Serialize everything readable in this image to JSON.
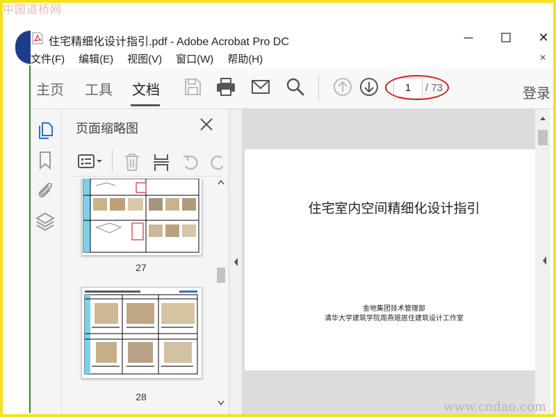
{
  "watermarks": {
    "top": "中国道桥网",
    "bottom": "www.cndao.com"
  },
  "window": {
    "title": "住宅精细化设计指引.pdf - Adobe Acrobat Pro DC",
    "minimize": "─",
    "close": "✕"
  },
  "menu": {
    "items": [
      {
        "label": "文件(F)"
      },
      {
        "label": "编辑(E)"
      },
      {
        "label": "视图(V)"
      },
      {
        "label": "窗口(W)"
      },
      {
        "label": "帮助(H)"
      }
    ],
    "close": "✕"
  },
  "toolbar": {
    "tabs": [
      {
        "label": "主页"
      },
      {
        "label": "工具"
      },
      {
        "label": "文档"
      }
    ],
    "active_tab": "文档",
    "icons": [
      "save-icon",
      "print-icon",
      "email-icon",
      "search-icon",
      "prev-page-icon",
      "next-page-icon"
    ],
    "page_number": "1",
    "page_total": "/ 73",
    "login": "登录",
    "highlight_color": "#d21f1f"
  },
  "left_rail": {
    "icons": [
      "page-thumbnails-icon",
      "bookmark-icon",
      "attachment-icon",
      "layers-icon"
    ],
    "accent_color": "#2b6fc2"
  },
  "thumbnail_panel": {
    "title": "页面缩略图",
    "close": "✕",
    "tool_icons": [
      "options-menu-icon",
      "delete-icon",
      "extract-icon",
      "undo-icon",
      "redo-icon"
    ],
    "thumbnails": [
      {
        "page_label": "27"
      },
      {
        "page_label": "28"
      }
    ]
  },
  "document": {
    "title": "住宅室内空间精细化设计指引",
    "subtitle_1": "金地集团技术管理部",
    "subtitle_2": "清华大学建筑学院周燕珉居住建筑设计工作室"
  }
}
